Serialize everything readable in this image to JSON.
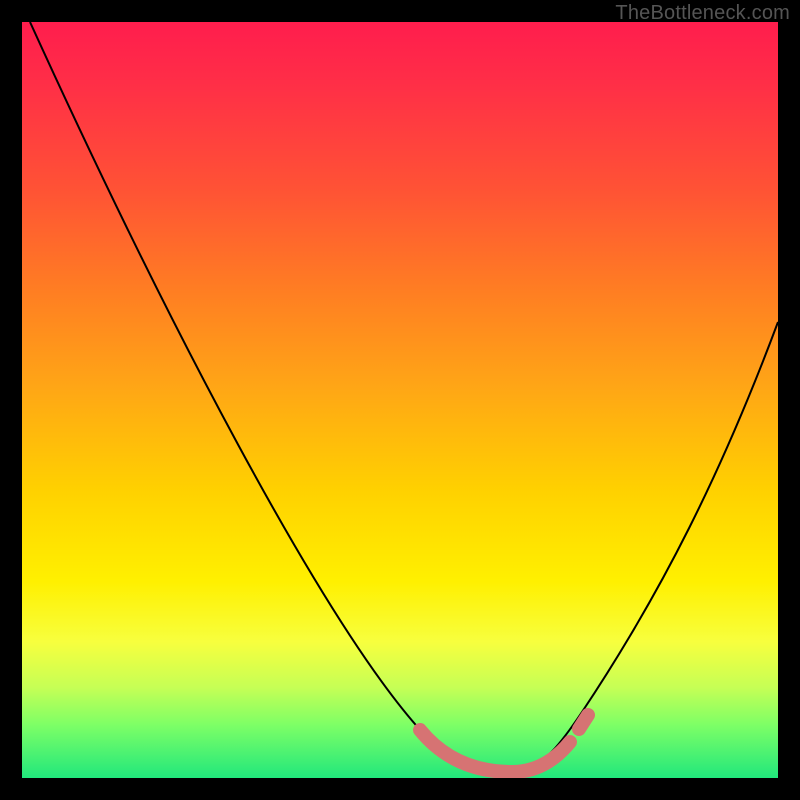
{
  "watermark": "TheBottleneck.com",
  "chart_data": {
    "type": "line",
    "title": "",
    "xlabel": "",
    "ylabel": "",
    "xlim": [
      0,
      100
    ],
    "ylim": [
      0,
      100
    ],
    "series": [
      {
        "name": "bottleneck-curve",
        "x": [
          1,
          10,
          20,
          30,
          40,
          48,
          54,
          58,
          62,
          66,
          70,
          74,
          80,
          86,
          92,
          99
        ],
        "y": [
          100,
          82,
          64,
          45,
          28,
          14,
          6,
          2,
          1,
          1,
          2,
          5,
          14,
          28,
          42,
          60
        ]
      },
      {
        "name": "highlight-segment",
        "x": [
          53,
          56,
          58,
          60,
          62,
          64,
          66,
          68,
          70,
          72,
          73
        ],
        "y": [
          7,
          3,
          2,
          1,
          1,
          1,
          1,
          1,
          2,
          3,
          4
        ]
      }
    ],
    "colors": {
      "curve": "#000000",
      "highlight": "#d67373",
      "gradient_top": "#ff1d4d",
      "gradient_bottom": "#21e77c"
    }
  }
}
